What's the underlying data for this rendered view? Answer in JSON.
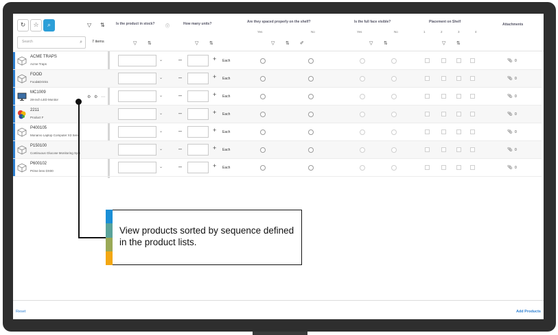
{
  "toolbar": {
    "icons": [
      "refresh-icon",
      "star-icon",
      "search-icon"
    ],
    "filter_icon": "filter-icon",
    "sort_icon": "sort-icon"
  },
  "search": {
    "placeholder": "Search",
    "items_count": "7 items"
  },
  "columns": {
    "in_stock": "Is the product in stock?",
    "units": "How many units?",
    "spaced": "Are they spaced properly on the shelf?",
    "spaced_yes": "Yes",
    "spaced_no": "No",
    "face": "Is the full face visible?",
    "face_yes": "Yes",
    "face_no": "No",
    "placement": "Placement on Shelf",
    "placement_opts": [
      "1",
      "2",
      "3",
      "4"
    ],
    "attachments": "Attachments"
  },
  "rows": [
    {
      "code": "ACME TRAPS",
      "name": "Acme Traps",
      "unit": "Each",
      "attachments": "0",
      "thumb": "box-icon"
    },
    {
      "code": "FOOD",
      "name": "Food&Drinks",
      "unit": "Each",
      "attachments": "0",
      "thumb": "box-icon"
    },
    {
      "code": "MC1009",
      "name": "28-inch LED Monitor",
      "unit": "Each",
      "attachments": "0",
      "thumb": "monitor-icon"
    },
    {
      "code": "2211",
      "name": "Product F",
      "unit": "Each",
      "attachments": "0",
      "thumb": "product-color-icon"
    },
    {
      "code": "P400105",
      "name": "Monarvo Laptop Computer X3 Serie",
      "unit": "Each",
      "attachments": "0",
      "thumb": "box-icon"
    },
    {
      "code": "P150100",
      "name": "Continuous Glucose Monitoring Syst",
      "unit": "Each",
      "attachments": "0",
      "thumb": "box-icon"
    },
    {
      "code": "P600102",
      "name": "Prime lens DX00",
      "unit": "Each",
      "attachments": "0",
      "thumb": "box-icon"
    }
  ],
  "footer": {
    "reset": "Reset",
    "add_products": "Add Products"
  },
  "callout": {
    "text": "View products sorted by sequence defined in the product lists.",
    "stripe_colors": [
      "#1a8fd6",
      "#5aa39a",
      "#9aa957",
      "#f3a712"
    ]
  },
  "colors": {
    "accent": "#2d9fd8",
    "row_bar": "#2d7fd1",
    "link": "#2d7fd1"
  }
}
